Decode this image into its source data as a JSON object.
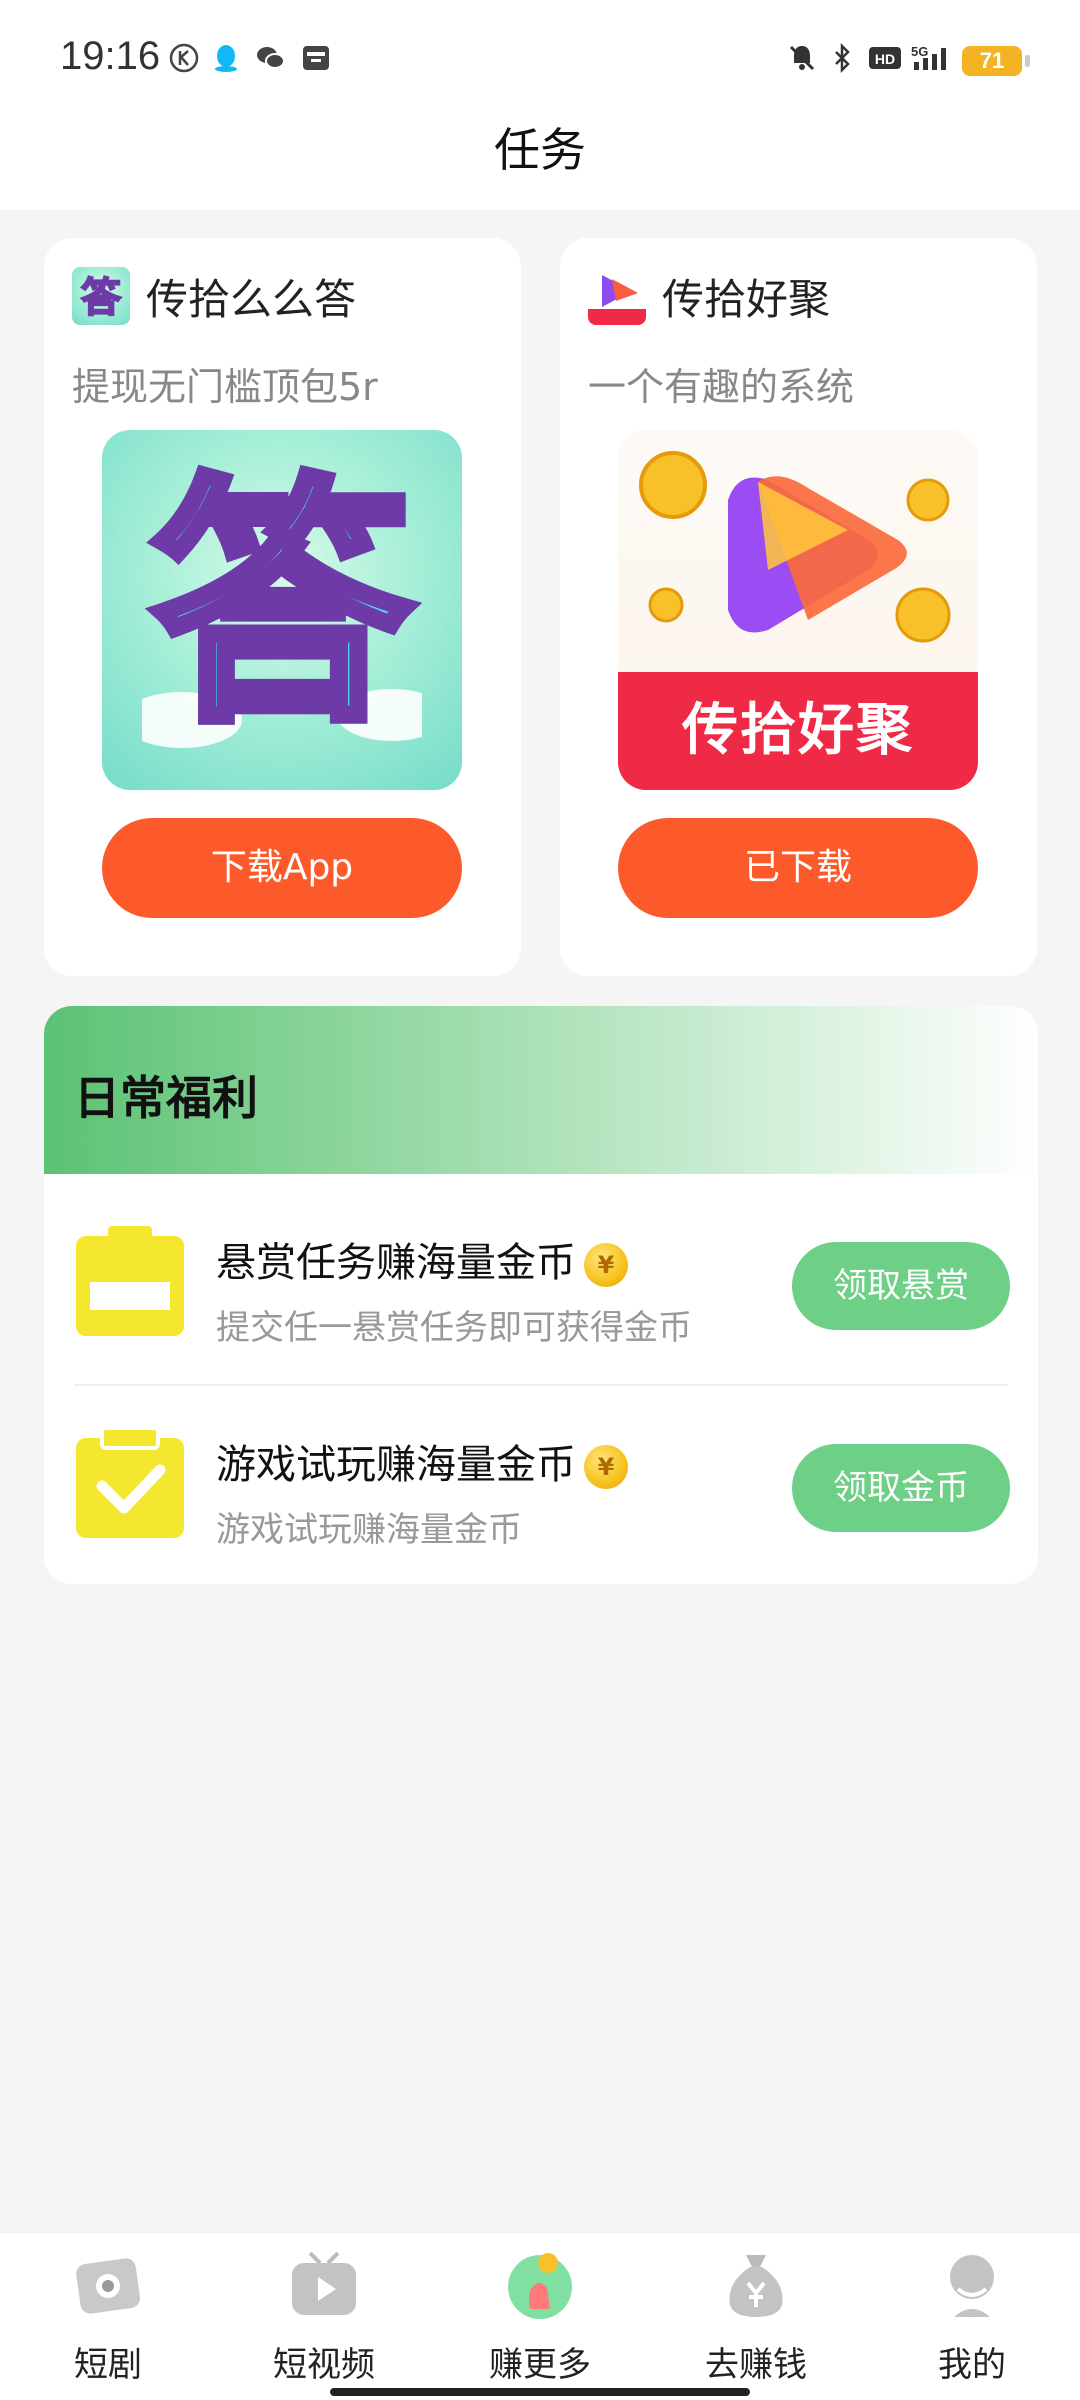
{
  "status_bar": {
    "time": "19:16",
    "battery": "71",
    "left_icons": [
      "k-circle-icon",
      "qq-icon",
      "wechat-icon",
      "inbox-icon"
    ],
    "right_icons": [
      "mute-bell-icon",
      "bluetooth-icon",
      "hd-icon",
      "5g-signal-icon"
    ]
  },
  "header": {
    "title": "任务"
  },
  "apps": [
    {
      "name": "传拾么么答",
      "desc": "提现无门槛顶包5r",
      "button": "下载App",
      "icon": "answer-app-icon",
      "image_char": "答"
    },
    {
      "name": "传拾好聚",
      "desc": "一个有趣的系统",
      "button": "已下载",
      "icon": "gather-app-icon",
      "banner": "传拾好聚"
    }
  ],
  "welfare": {
    "title": "日常福利",
    "tasks": [
      {
        "title": "悬赏任务赚海量金币",
        "desc": "提交任一悬赏任务即可获得金币",
        "button": "领取悬赏",
        "icon": "clipboard-icon"
      },
      {
        "title": "游戏试玩赚海量金币",
        "desc": "游戏试玩赚海量金币",
        "button": "领取金币",
        "icon": "clipboard-check-icon"
      }
    ],
    "coin_symbol": "¥"
  },
  "tabs": [
    {
      "label": "短剧",
      "icon": "short-drama-icon"
    },
    {
      "label": "短视频",
      "icon": "tv-play-icon"
    },
    {
      "label": "赚更多",
      "icon": "earn-more-icon",
      "active": true
    },
    {
      "label": "去赚钱",
      "icon": "money-bag-icon"
    },
    {
      "label": "我的",
      "icon": "profile-icon"
    }
  ],
  "colors": {
    "accent_orange": "#fc5a2b",
    "accent_green": "#6ecf87",
    "yellow": "#f5e62f"
  }
}
